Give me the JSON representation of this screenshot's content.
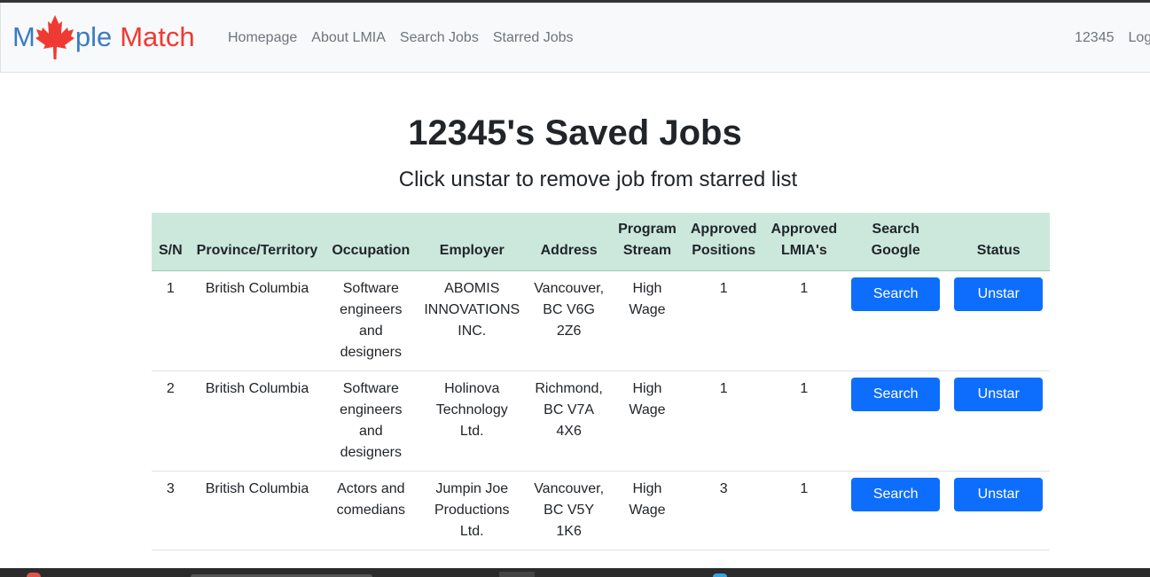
{
  "brand": {
    "part1": "M",
    "part2": "ple",
    "part3": "Match"
  },
  "nav": {
    "links": [
      "Homepage",
      "About LMIA",
      "Search Jobs",
      "Starred Jobs"
    ],
    "user": "12345",
    "logout": "Log"
  },
  "page": {
    "title": "12345's Saved Jobs",
    "subtitle": "Click unstar to remove job from starred list"
  },
  "table": {
    "headers": {
      "sn": "S/N",
      "province": "Province/Territory",
      "occupation": "Occupation",
      "employer": "Employer",
      "address": "Address",
      "program_l1": "Program",
      "program_l2": "Stream",
      "positions_l1": "Approved",
      "positions_l2": "Positions",
      "lmias_l1": "Approved",
      "lmias_l2": "LMIA's",
      "google_l1": "Search",
      "google_l2": "Google",
      "status": "Status"
    },
    "rows": [
      {
        "sn": "1",
        "province": "British Columbia",
        "occupation": [
          "Software",
          "engineers",
          "and",
          "designers"
        ],
        "employer": [
          "ABOMIS",
          "INNOVATIONS",
          "INC."
        ],
        "address": [
          "Vancouver,",
          "BC V6G",
          "2Z6"
        ],
        "stream": [
          "High",
          "Wage"
        ],
        "positions": "1",
        "lmias": "1",
        "search_label": "Search",
        "unstar_label": "Unstar"
      },
      {
        "sn": "2",
        "province": "British Columbia",
        "occupation": [
          "Software",
          "engineers",
          "and",
          "designers"
        ],
        "employer": [
          "Holinova",
          "Technology",
          "Ltd."
        ],
        "address": [
          "Richmond,",
          "BC V7A",
          "4X6"
        ],
        "stream": [
          "High",
          "Wage"
        ],
        "positions": "1",
        "lmias": "1",
        "search_label": "Search",
        "unstar_label": "Unstar"
      },
      {
        "sn": "3",
        "province": "British Columbia",
        "occupation": [
          "Actors and",
          "comedians"
        ],
        "employer": [
          "Jumpin Joe",
          "Productions",
          "Ltd."
        ],
        "address": [
          "Vancouver,",
          "BC V5Y",
          "1K6"
        ],
        "stream": [
          "High",
          "Wage"
        ],
        "positions": "3",
        "lmias": "1",
        "search_label": "Search",
        "unstar_label": "Unstar"
      }
    ]
  },
  "colors": {
    "brand_blue": "#3a7cc2",
    "brand_red": "#ef3a33",
    "header_bg": "#cce8dd",
    "button_blue": "#0d6efd"
  },
  "icons": {
    "logo_leaf": "maple-leaf-icon"
  }
}
